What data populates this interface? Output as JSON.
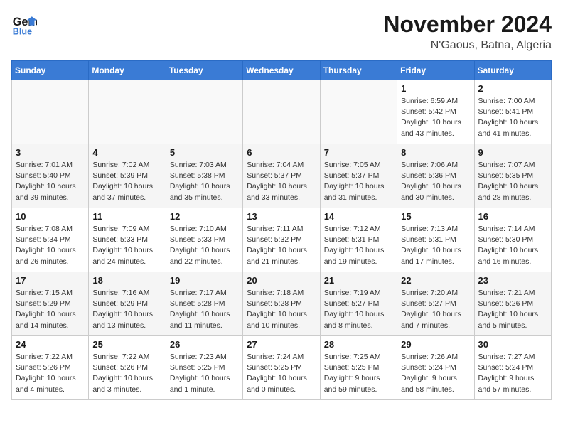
{
  "header": {
    "logo_line1": "General",
    "logo_line2": "Blue",
    "month": "November 2024",
    "location": "N'Gaous, Batna, Algeria"
  },
  "weekdays": [
    "Sunday",
    "Monday",
    "Tuesday",
    "Wednesday",
    "Thursday",
    "Friday",
    "Saturday"
  ],
  "weeks": [
    [
      {
        "day": "",
        "info": ""
      },
      {
        "day": "",
        "info": ""
      },
      {
        "day": "",
        "info": ""
      },
      {
        "day": "",
        "info": ""
      },
      {
        "day": "",
        "info": ""
      },
      {
        "day": "1",
        "info": "Sunrise: 6:59 AM\nSunset: 5:42 PM\nDaylight: 10 hours and 43 minutes."
      },
      {
        "day": "2",
        "info": "Sunrise: 7:00 AM\nSunset: 5:41 PM\nDaylight: 10 hours and 41 minutes."
      }
    ],
    [
      {
        "day": "3",
        "info": "Sunrise: 7:01 AM\nSunset: 5:40 PM\nDaylight: 10 hours and 39 minutes."
      },
      {
        "day": "4",
        "info": "Sunrise: 7:02 AM\nSunset: 5:39 PM\nDaylight: 10 hours and 37 minutes."
      },
      {
        "day": "5",
        "info": "Sunrise: 7:03 AM\nSunset: 5:38 PM\nDaylight: 10 hours and 35 minutes."
      },
      {
        "day": "6",
        "info": "Sunrise: 7:04 AM\nSunset: 5:37 PM\nDaylight: 10 hours and 33 minutes."
      },
      {
        "day": "7",
        "info": "Sunrise: 7:05 AM\nSunset: 5:37 PM\nDaylight: 10 hours and 31 minutes."
      },
      {
        "day": "8",
        "info": "Sunrise: 7:06 AM\nSunset: 5:36 PM\nDaylight: 10 hours and 30 minutes."
      },
      {
        "day": "9",
        "info": "Sunrise: 7:07 AM\nSunset: 5:35 PM\nDaylight: 10 hours and 28 minutes."
      }
    ],
    [
      {
        "day": "10",
        "info": "Sunrise: 7:08 AM\nSunset: 5:34 PM\nDaylight: 10 hours and 26 minutes."
      },
      {
        "day": "11",
        "info": "Sunrise: 7:09 AM\nSunset: 5:33 PM\nDaylight: 10 hours and 24 minutes."
      },
      {
        "day": "12",
        "info": "Sunrise: 7:10 AM\nSunset: 5:33 PM\nDaylight: 10 hours and 22 minutes."
      },
      {
        "day": "13",
        "info": "Sunrise: 7:11 AM\nSunset: 5:32 PM\nDaylight: 10 hours and 21 minutes."
      },
      {
        "day": "14",
        "info": "Sunrise: 7:12 AM\nSunset: 5:31 PM\nDaylight: 10 hours and 19 minutes."
      },
      {
        "day": "15",
        "info": "Sunrise: 7:13 AM\nSunset: 5:31 PM\nDaylight: 10 hours and 17 minutes."
      },
      {
        "day": "16",
        "info": "Sunrise: 7:14 AM\nSunset: 5:30 PM\nDaylight: 10 hours and 16 minutes."
      }
    ],
    [
      {
        "day": "17",
        "info": "Sunrise: 7:15 AM\nSunset: 5:29 PM\nDaylight: 10 hours and 14 minutes."
      },
      {
        "day": "18",
        "info": "Sunrise: 7:16 AM\nSunset: 5:29 PM\nDaylight: 10 hours and 13 minutes."
      },
      {
        "day": "19",
        "info": "Sunrise: 7:17 AM\nSunset: 5:28 PM\nDaylight: 10 hours and 11 minutes."
      },
      {
        "day": "20",
        "info": "Sunrise: 7:18 AM\nSunset: 5:28 PM\nDaylight: 10 hours and 10 minutes."
      },
      {
        "day": "21",
        "info": "Sunrise: 7:19 AM\nSunset: 5:27 PM\nDaylight: 10 hours and 8 minutes."
      },
      {
        "day": "22",
        "info": "Sunrise: 7:20 AM\nSunset: 5:27 PM\nDaylight: 10 hours and 7 minutes."
      },
      {
        "day": "23",
        "info": "Sunrise: 7:21 AM\nSunset: 5:26 PM\nDaylight: 10 hours and 5 minutes."
      }
    ],
    [
      {
        "day": "24",
        "info": "Sunrise: 7:22 AM\nSunset: 5:26 PM\nDaylight: 10 hours and 4 minutes."
      },
      {
        "day": "25",
        "info": "Sunrise: 7:22 AM\nSunset: 5:26 PM\nDaylight: 10 hours and 3 minutes."
      },
      {
        "day": "26",
        "info": "Sunrise: 7:23 AM\nSunset: 5:25 PM\nDaylight: 10 hours and 1 minute."
      },
      {
        "day": "27",
        "info": "Sunrise: 7:24 AM\nSunset: 5:25 PM\nDaylight: 10 hours and 0 minutes."
      },
      {
        "day": "28",
        "info": "Sunrise: 7:25 AM\nSunset: 5:25 PM\nDaylight: 9 hours and 59 minutes."
      },
      {
        "day": "29",
        "info": "Sunrise: 7:26 AM\nSunset: 5:24 PM\nDaylight: 9 hours and 58 minutes."
      },
      {
        "day": "30",
        "info": "Sunrise: 7:27 AM\nSunset: 5:24 PM\nDaylight: 9 hours and 57 minutes."
      }
    ]
  ]
}
